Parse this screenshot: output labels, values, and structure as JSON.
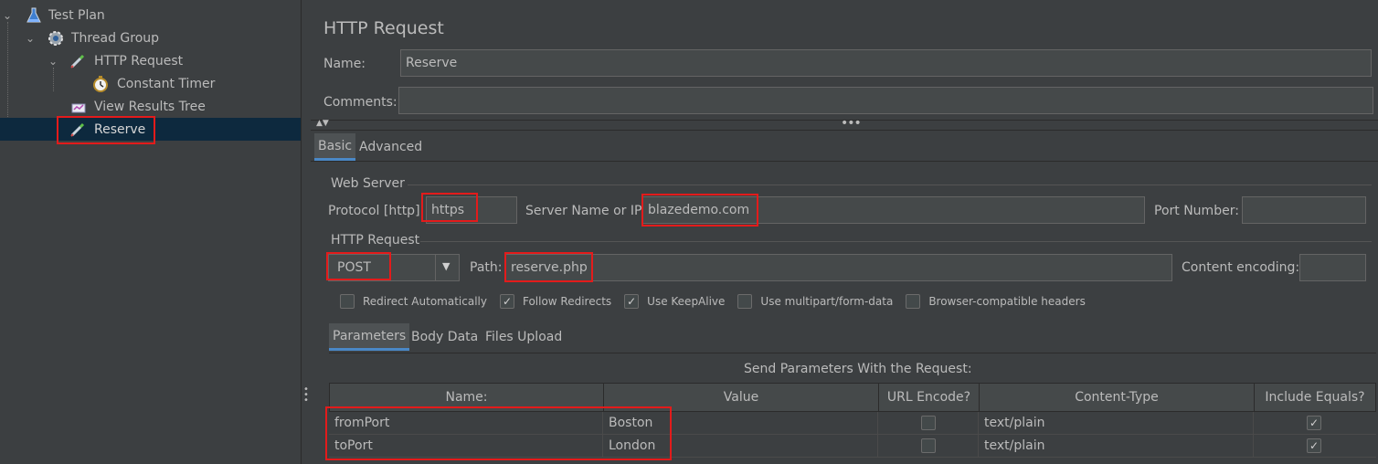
{
  "tree": {
    "items": [
      {
        "label": "Test Plan",
        "icon": "flask-icon"
      },
      {
        "label": "Thread Group",
        "icon": "gear-icon"
      },
      {
        "label": "HTTP Request",
        "icon": "pipette-icon"
      },
      {
        "label": "Constant Timer",
        "icon": "stopwatch-icon"
      },
      {
        "label": "View Results Tree",
        "icon": "results-tree-icon"
      },
      {
        "label": "Reserve",
        "icon": "pipette-icon"
      }
    ]
  },
  "panel": {
    "title": "HTTP Request",
    "name_label": "Name:",
    "name_value": "Reserve",
    "comments_label": "Comments:",
    "comments_value": "",
    "tabs": [
      "Basic",
      "Advanced"
    ],
    "web_server": {
      "group_label": "Web Server",
      "protocol_label": "Protocol [http]:",
      "protocol_value": "https",
      "server_label": "Server Name or IP:",
      "server_value": "blazedemo.com",
      "port_label": "Port Number:",
      "port_value": ""
    },
    "http_request": {
      "group_label": "HTTP Request",
      "method": "POST",
      "path_label": "Path:",
      "path_value": "reserve.php",
      "encoding_label": "Content encoding:",
      "encoding_value": ""
    },
    "options": [
      {
        "label": "Redirect Automatically",
        "checked": false
      },
      {
        "label": "Follow Redirects",
        "checked": true
      },
      {
        "label": "Use KeepAlive",
        "checked": true
      },
      {
        "label": "Use multipart/form-data",
        "checked": false
      },
      {
        "label": "Browser-compatible headers",
        "checked": false
      }
    ],
    "sub_tabs": [
      "Parameters",
      "Body Data",
      "Files Upload"
    ],
    "params_caption": "Send Parameters With the Request:",
    "table": {
      "headers": [
        "Name:",
        "Value",
        "URL Encode?",
        "Content-Type",
        "Include Equals?"
      ],
      "rows": [
        {
          "name": "fromPort",
          "value": "Boston",
          "url_encode": false,
          "content_type": "text/plain",
          "include_equals": true
        },
        {
          "name": "toPort",
          "value": "London",
          "url_encode": false,
          "content_type": "text/plain",
          "include_equals": true
        }
      ]
    }
  },
  "colors": {
    "background": "#3c3f41",
    "selected_row": "#0d293e",
    "highlight": "#e31b1b",
    "tab_accent": "#4a88c7"
  }
}
